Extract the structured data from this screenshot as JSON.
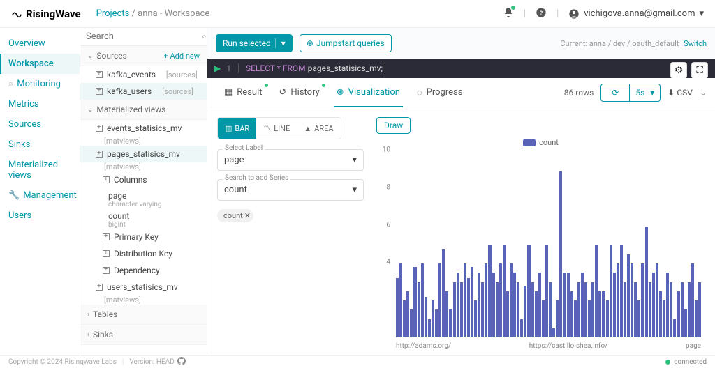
{
  "header": {
    "brand": "RisingWave",
    "breadcrumb_root": "Projects",
    "breadcrumb_current": "anna - Workspace",
    "user": "vichigova.anna@gmail.com"
  },
  "leftnav": {
    "overview": "Overview",
    "workspace": "Workspace",
    "monitoring": "Monitoring",
    "metrics": "Metrics",
    "sources": "Sources",
    "sinks": "Sinks",
    "mviews": "Materialized views",
    "management": "Management",
    "users": "Users"
  },
  "tree": {
    "search_ph": "Search",
    "add_new": "+ Add new",
    "sec_sources": "Sources",
    "sec_mviews": "Materialized views",
    "sec_tables": "Tables",
    "sec_sinks": "Sinks",
    "tag_sources": "[sources]",
    "tag_matviews": "[matviews]",
    "kafka_events": "kafka_events",
    "kafka_users": "kafka_users",
    "events_mv": "events_statisics_mv",
    "pages_mv": "pages_statisics_mv",
    "users_mv": "users_statisics_mv",
    "columns": "Columns",
    "col_page": "page",
    "col_page_t": "character varying",
    "col_count": "count",
    "col_count_t": "bigint",
    "pk": "Primary Key",
    "dk": "Distribution Key",
    "dep": "Dependency"
  },
  "run": {
    "run_selected": "Run selected",
    "jumpstart": "Jumpstart queries",
    "current_label": "Current:",
    "current_path": "anna / dev / oauth_default",
    "switch": "Switch"
  },
  "editor": {
    "line": "1",
    "kw": "SELECT * FROM ",
    "id": "pages_statisics_mv",
    "semi": ";"
  },
  "tabs": {
    "result": "Result",
    "history": "History",
    "visualization": "Visualization",
    "progress": "Progress",
    "rows": "86 rows",
    "interval": "5s",
    "csv": "CSV"
  },
  "viz": {
    "bar": "BAR",
    "line": "LINE",
    "area": "AREA",
    "label_lbl": "Select Label",
    "label_val": "page",
    "series_lbl": "Search to add Series",
    "series_val": "count",
    "chip": "count",
    "draw": "Draw",
    "legend": "count"
  },
  "chart_data": {
    "type": "bar",
    "ylabel": "count",
    "xlabel": "page",
    "ylim": [
      0,
      10
    ],
    "yticks": [
      10,
      8,
      6,
      4
    ],
    "x_sample_labels": [
      "http://adams.org/",
      "https://castillo-shea.info/",
      "page"
    ],
    "values": [
      3.2,
      4.0,
      2.0,
      2.5,
      1.5,
      3.8,
      3.0,
      4.0,
      2.2,
      1.0,
      2.0,
      1.5,
      4.0,
      4.8,
      2.5,
      1.5,
      3.0,
      3.5,
      3.0,
      4.0,
      3.2,
      3.8,
      2.0,
      3.5,
      3.0,
      4.0,
      5.0,
      3.5,
      3.0,
      4.0,
      5.0,
      2.5,
      4.0,
      3.5,
      3.0,
      1.0,
      2.8,
      5.0,
      3.0,
      2.5,
      3.5,
      2.0,
      5.0,
      3.0,
      0.5,
      2.0,
      9.0,
      3.5,
      3.5,
      2.5,
      2.0,
      3.0,
      3.5,
      3.0,
      2.0,
      3.0,
      5.0,
      2.5,
      2.5,
      2.0,
      5.0,
      3.5,
      4.0,
      5.0,
      3.0,
      4.5,
      4.0,
      3.0,
      2.0,
      4.0,
      6.0,
      3.0,
      3.5,
      4.0,
      2.5,
      2.0,
      3.5,
      3.0,
      1.0,
      2.5,
      3.0,
      1.5,
      3.0,
      4.0,
      2.0,
      3.0
    ]
  },
  "footer": {
    "copyright": "Copyright © 2024 Risingwave Labs",
    "version": "Version: HEAD",
    "status": "connected"
  }
}
